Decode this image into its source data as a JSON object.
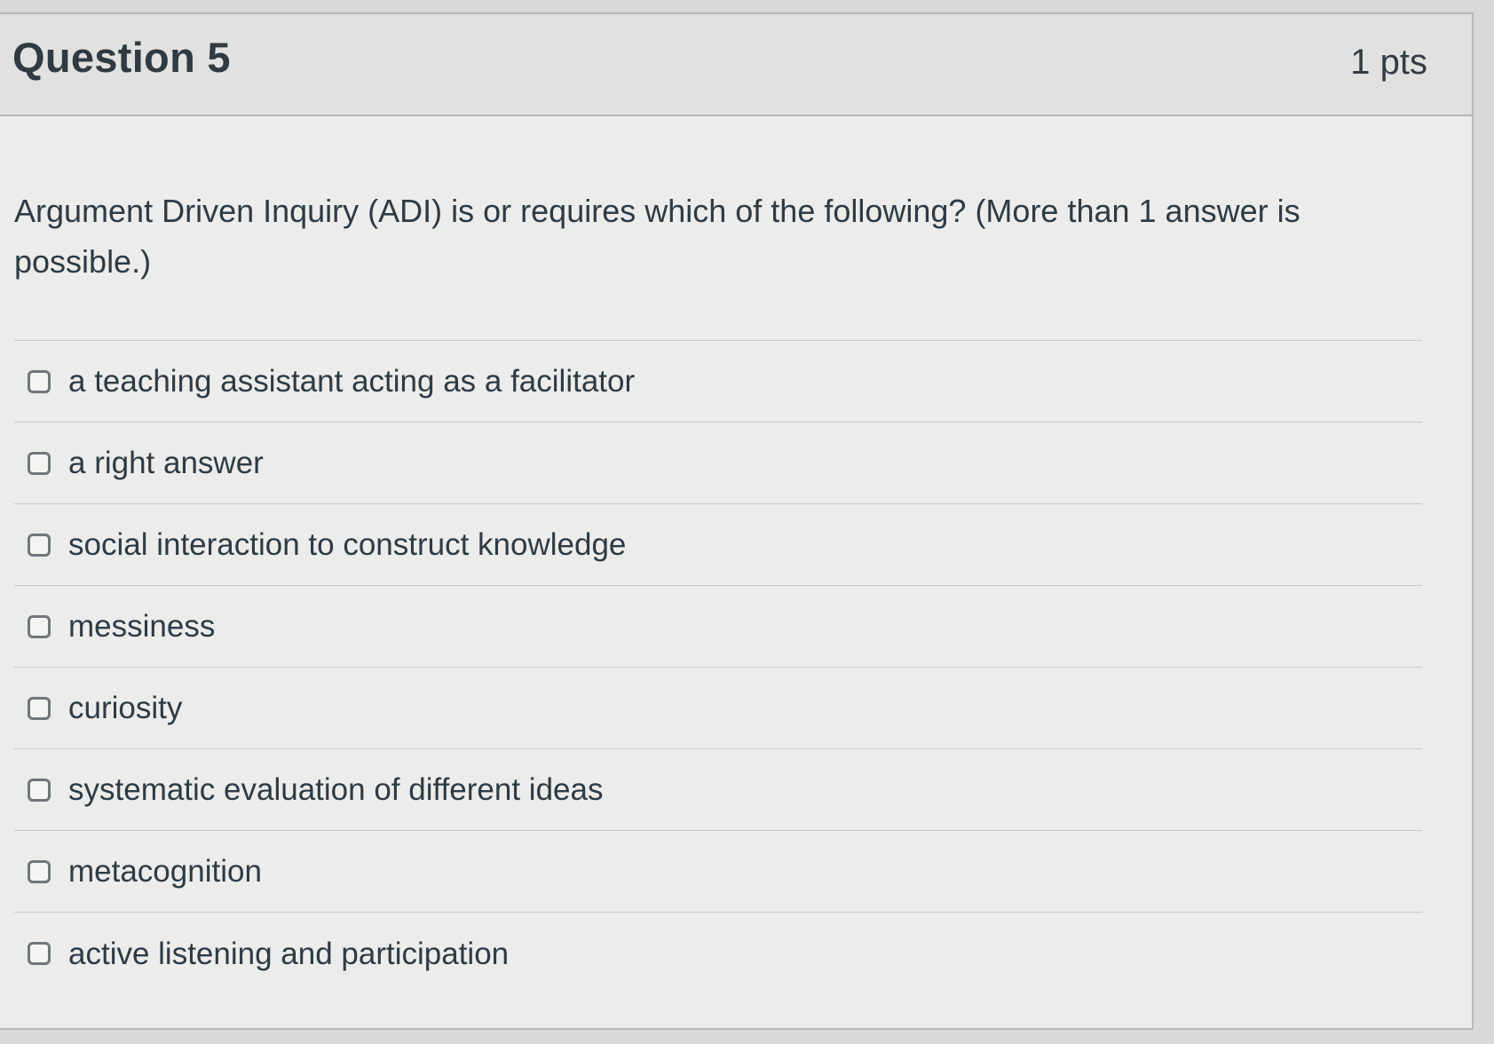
{
  "question": {
    "title": "Question 5",
    "points": "1 pts",
    "text": "Argument Driven Inquiry (ADI) is or requires which of the following?  (More than 1 answer is possible.)"
  },
  "answers": [
    {
      "label": "a teaching assistant acting as a facilitator",
      "checked": false
    },
    {
      "label": "a right answer",
      "checked": false
    },
    {
      "label": "social interaction to construct knowledge",
      "checked": false
    },
    {
      "label": "messiness",
      "checked": false
    },
    {
      "label": "curiosity",
      "checked": false
    },
    {
      "label": "systematic evaluation of different ideas",
      "checked": false
    },
    {
      "label": "metacognition",
      "checked": false
    },
    {
      "label": "active listening and participation",
      "checked": false
    }
  ]
}
